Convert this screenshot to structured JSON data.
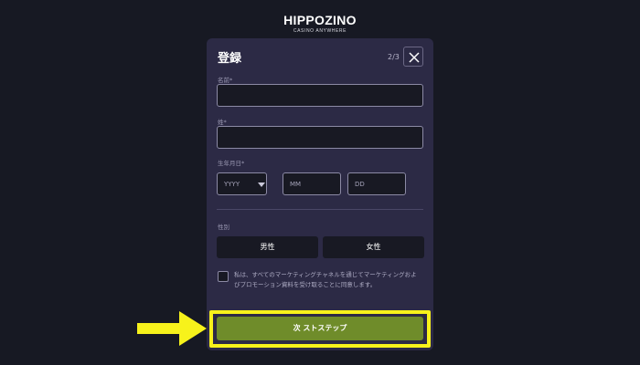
{
  "logo": {
    "main": "HIPPOZINO",
    "sub": "CASINO ANYWHERE"
  },
  "modal": {
    "title": "登録",
    "step": "2/3",
    "fields": {
      "first_name_label": "名前*",
      "last_name_label": "姓*",
      "first_name_value": "",
      "last_name_value": ""
    },
    "birth_date": {
      "label": "生年月日*",
      "year_placeholder": "YYYY",
      "month_placeholder": "MM",
      "day_placeholder": "DD"
    },
    "gender": {
      "label": "性別",
      "options": [
        "男性",
        "女性"
      ]
    },
    "consent": {
      "checked": false,
      "text": "私は、すべてのマーケティングチャネルを通じてマーケティングおよびプロモーション資料を受け取ることに同意します。"
    },
    "next_button": "次 ストステップ"
  },
  "annotation": {
    "highlight_color": "#f7f21b",
    "arrow_color": "#f7f21b"
  },
  "colors": {
    "background": "#171923",
    "modal": "#2c2a45",
    "button": "#6f8c2a"
  }
}
